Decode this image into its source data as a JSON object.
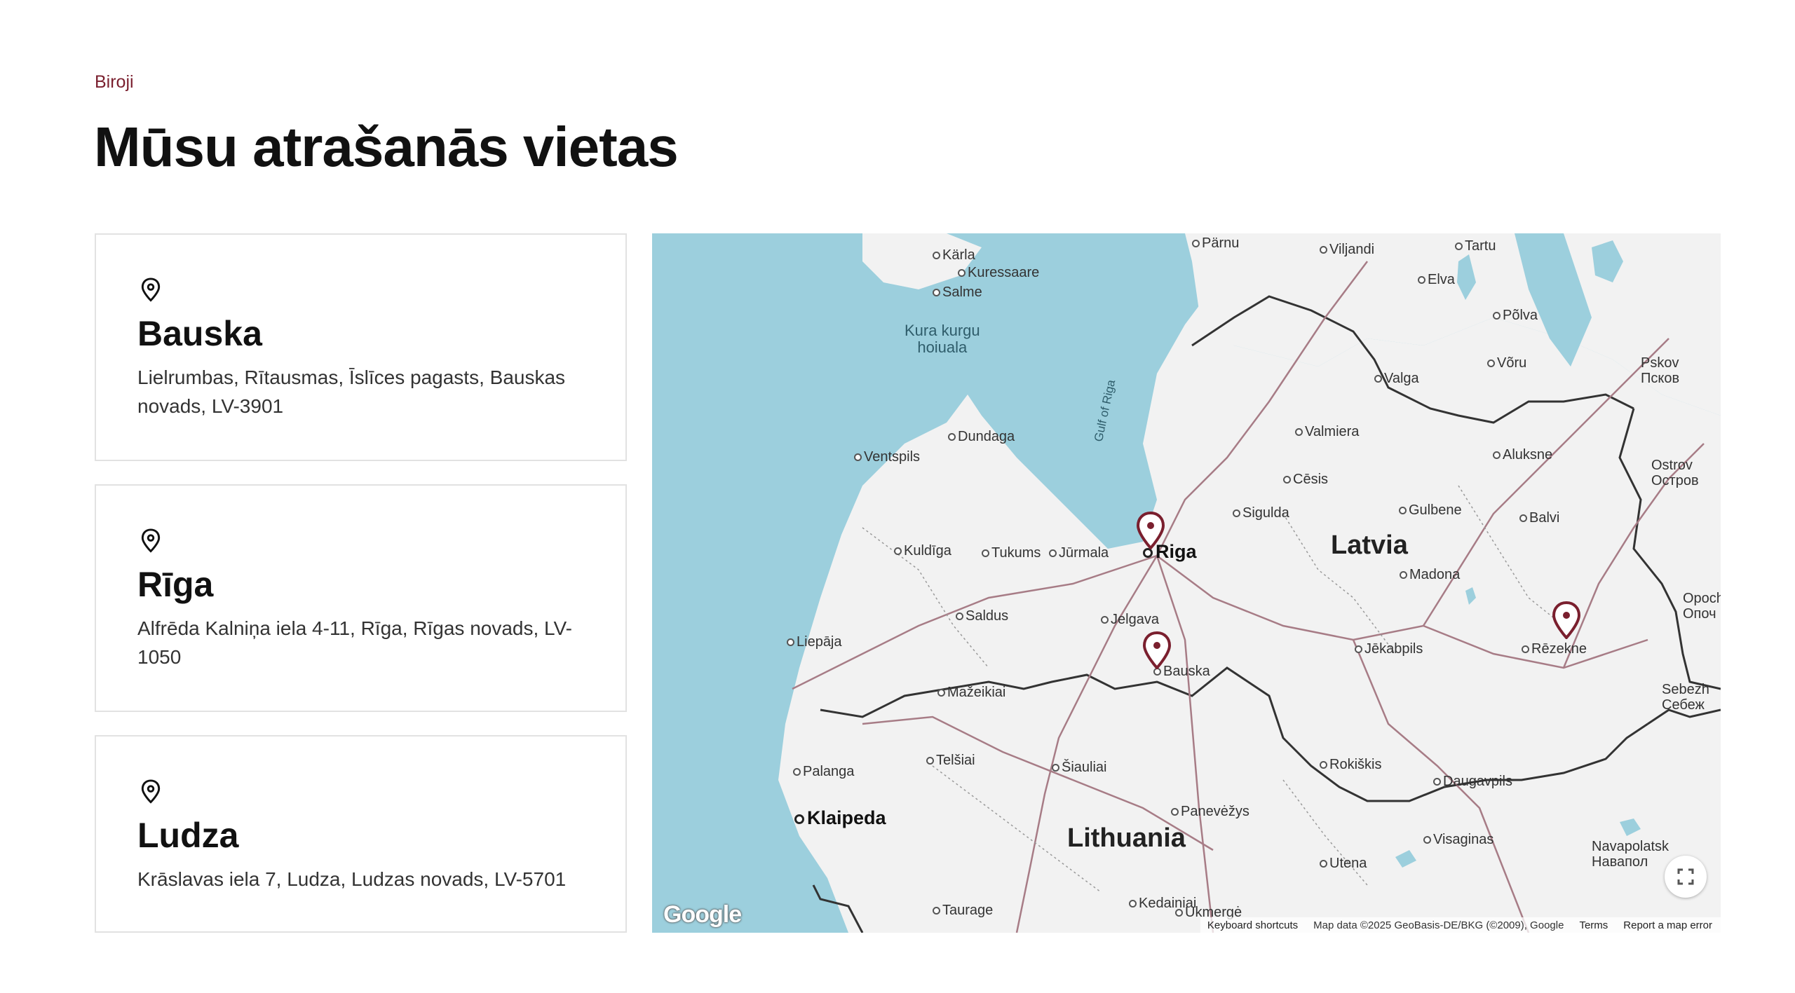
{
  "header": {
    "eyebrow": "Biroji",
    "title": "Mūsu atrašanās vietas"
  },
  "offices": [
    {
      "name": "Bauska",
      "address": "Lielrumbas, Rītausmas, Īslīces pagasts, Bauskas novads, LV-3901",
      "icon": "location-pin-icon"
    },
    {
      "name": "Rīga",
      "address": "Alfrēda Kalniņa iela 4-11, Rīga, Rīgas novads, LV-1050",
      "icon": "location-pin-icon"
    },
    {
      "name": "Ludza",
      "address": "Krāslavas iela 7, Ludza, Ludzas novads, LV-5701",
      "icon": "location-pin-icon"
    }
  ],
  "map": {
    "countries": {
      "latvia": "Latvia",
      "lithuania": "Lithuania"
    },
    "waters": {
      "gulf": "Gulf of Riga",
      "kura_1": "Kura kurgu",
      "kura_2": "hoiuala"
    },
    "cities": {
      "karla": "Kärla",
      "kuressaare": "Kuressaare",
      "salme": "Salme",
      "parnu": "Pärnu",
      "viljandi": "Viljandi",
      "tartu": "Tartu",
      "elva": "Elva",
      "polva": "Põlva",
      "voru": "Võru",
      "valga": "Valga",
      "pskov_1": "Pskov",
      "pskov_2": "Псков",
      "dundaga": "Dundaga",
      "ventspils": "Ventspils",
      "valmiera": "Valmiera",
      "aluksne": "Aluksne",
      "ostrov_1": "Ostrov",
      "ostrov_2": "Остров",
      "cesis": "Cēsis",
      "sigulda": "Sigulda",
      "gulbene": "Gulbene",
      "balvi": "Balvi",
      "kuldiga": "Kuldīga",
      "tukums": "Tukums",
      "jurmala": "Jūrmala",
      "riga": "Riga",
      "madona": "Madona",
      "opochka_1": "Opoch",
      "opochka_2": "Опоч",
      "saldus": "Saldus",
      "jelgava": "Jelgava",
      "liepaja": "Liepāja",
      "jekabpils": "Jēkabpils",
      "rezekne": "Rēzekne",
      "bauska": "Bauska",
      "mazeikiai": "Mažeikiai",
      "sebezh_1": "Sebezh",
      "sebezh_2": "Себеж",
      "telsiai": "Telšiai",
      "siauliai": "Šiauliai",
      "rokiskis": "Rokiškis",
      "palanga": "Palanga",
      "daugavpils": "Daugavpils",
      "klaipeda": "Klaipeda",
      "panevezys": "Panevėžys",
      "visaginas": "Visaginas",
      "utena": "Utena",
      "novopolotsk_1": "Navapolatsk",
      "novopolotsk_2": "Навапол",
      "kedainiai": "Kedainiai",
      "taurage": "Taurage",
      "ukmerge": "Ukmergė"
    },
    "google_logo": "Google",
    "attribution": {
      "shortcuts": "Keyboard shortcuts",
      "data": "Map data ©2025 GeoBasis-DE/BKG (©2009), Google",
      "terms": "Terms",
      "report": "Report a map error"
    },
    "marker_color": "#7a1f2e",
    "water_color": "#9ccfdd",
    "land_color": "#f2f2f2"
  }
}
